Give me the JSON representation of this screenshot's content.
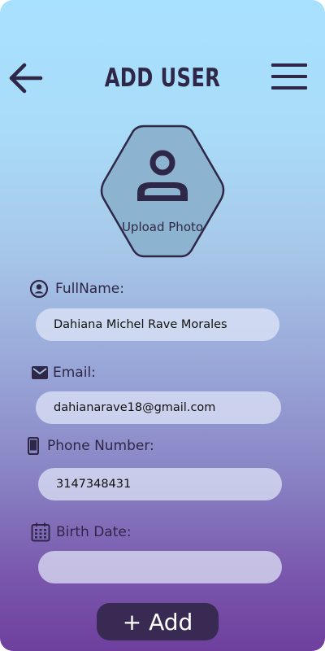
{
  "header": {
    "title": "ADD USER",
    "back_icon": "arrow-left-icon",
    "menu_icon": "hamburger-menu-icon"
  },
  "photo": {
    "label": "Upload Photo",
    "icon": "user-icon"
  },
  "form": {
    "full_name": {
      "label": "FullName:",
      "value": "Dahiana Michel Rave Morales",
      "icon": "user-circle-icon"
    },
    "email": {
      "label": "Email:",
      "value": "dahianarave18@gmail.com",
      "icon": "mail-icon"
    },
    "phone": {
      "label": "Phone Number:",
      "value": "3147348431",
      "icon": "phone-icon"
    },
    "birth_date": {
      "label": "Birth Date:",
      "value": "",
      "icon": "calendar-icon"
    }
  },
  "add_button": {
    "label": "+ Add"
  },
  "colors": {
    "primary_dark": "#382a52",
    "text": "#2f2748",
    "input_bg": "#e2e8f8"
  }
}
